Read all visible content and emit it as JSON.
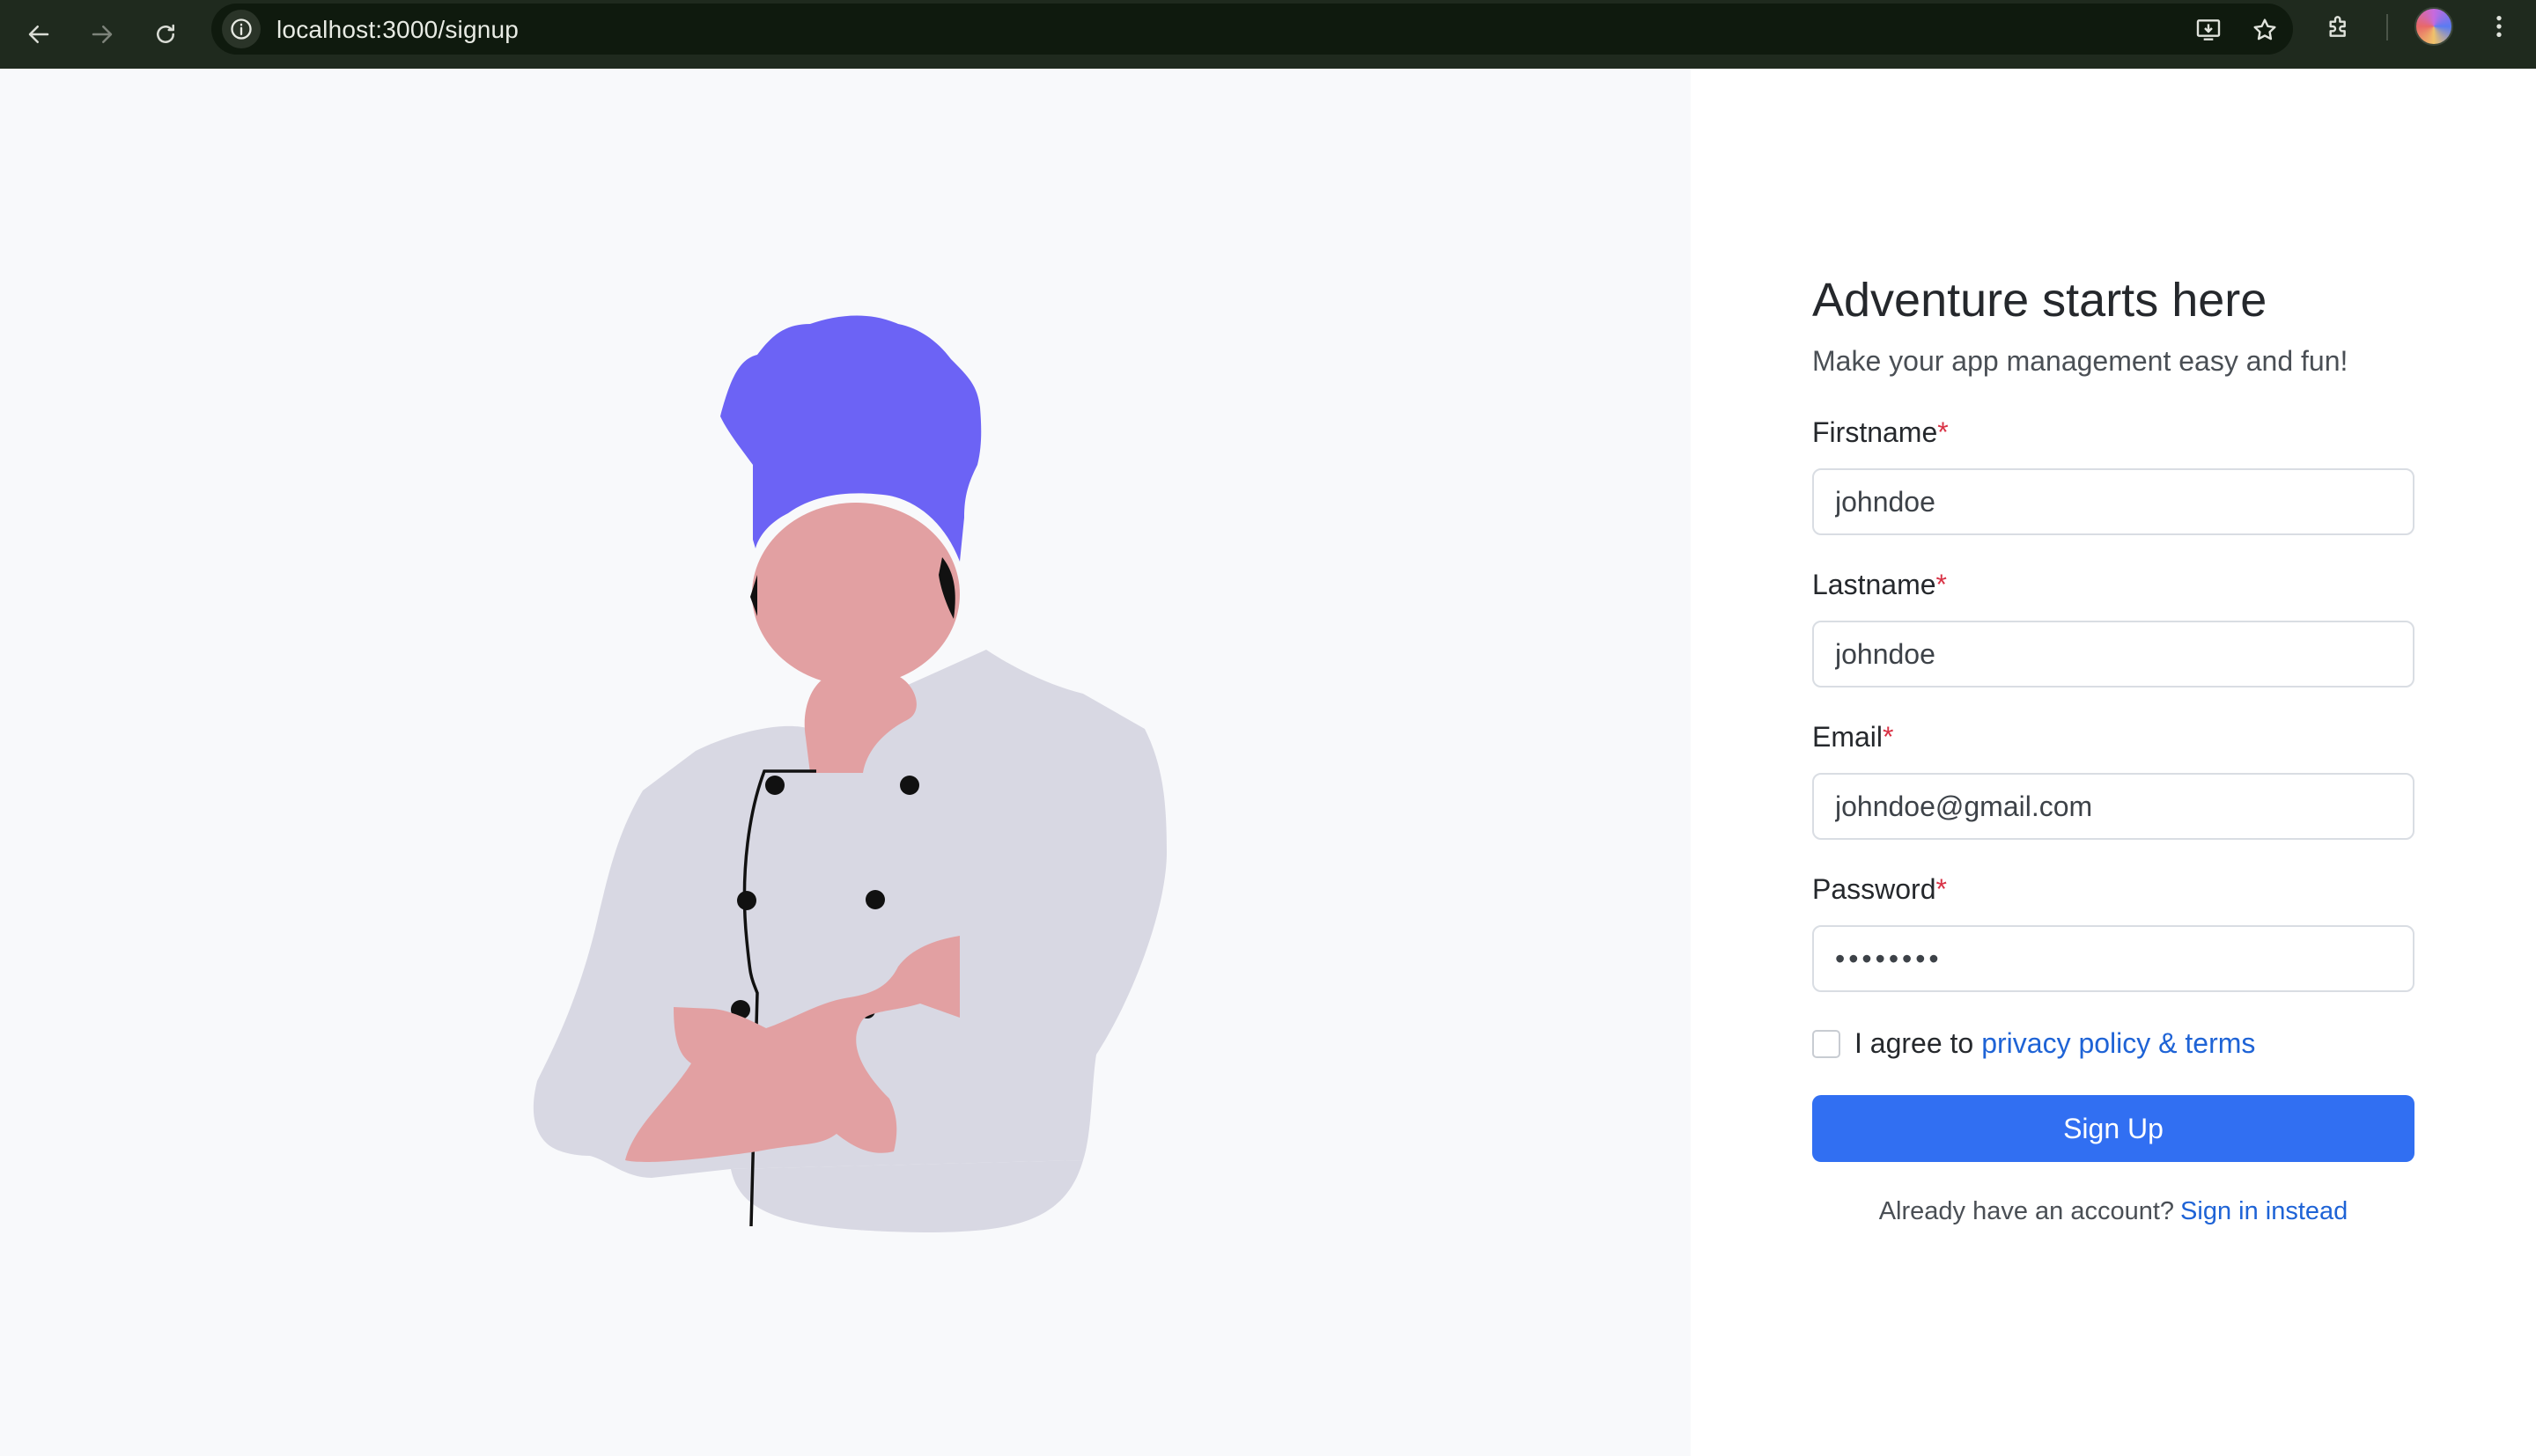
{
  "browser": {
    "url": "localhost:3000/signup",
    "icons": [
      "back-arrow-icon",
      "forward-arrow-icon",
      "reload-icon",
      "site-info-icon",
      "install-app-icon",
      "bookmark-star-icon",
      "extensions-icon",
      "profile-avatar",
      "more-menu-icon"
    ]
  },
  "signup": {
    "title": "Adventure starts here",
    "subtitle": "Make your app management easy and fun!",
    "required_mark": "*",
    "fields": [
      {
        "label": "Firstname",
        "placeholder": "johndoe"
      },
      {
        "label": "Lastname",
        "placeholder": "johndoe"
      },
      {
        "label": "Email",
        "placeholder": "johndoe@gmail.com"
      },
      {
        "label": "Password",
        "value": "••••••••"
      }
    ],
    "agree_prefix": "I agree to",
    "agree_link": "privacy policy & terms",
    "agree_checked": false,
    "submit_label": "Sign Up",
    "signin_prompt": "Already have an account?",
    "signin_link": "Sign in instead"
  },
  "colors": {
    "primary": "#316ff2",
    "link": "#1e63d6",
    "required": "#d93346",
    "chef_hat": "#6c63f5",
    "skin": "#e2a0a2",
    "coat": "#d8d8e3",
    "browser_bar": "#1f2a1e"
  }
}
